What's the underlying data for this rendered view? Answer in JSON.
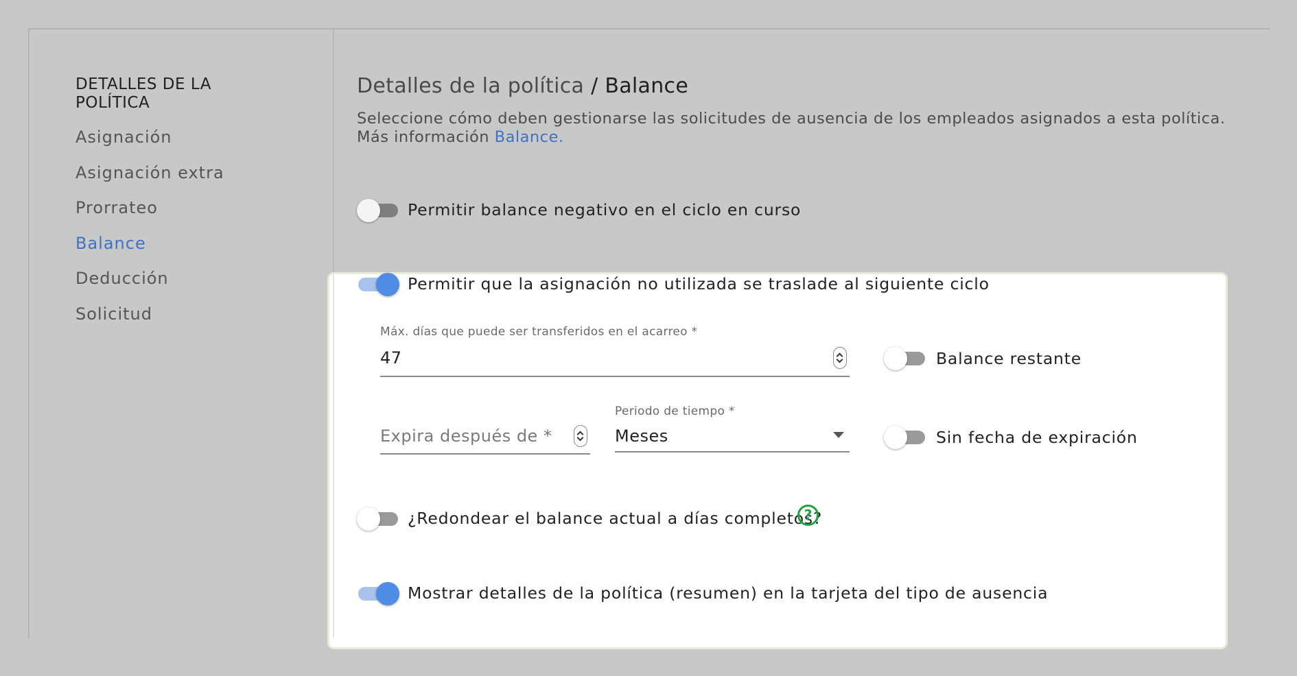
{
  "sidebar": {
    "heading": "DETALLES DE LA POLÍTICA",
    "items": [
      {
        "label": "Asignación",
        "active": false
      },
      {
        "label": "Asignación extra",
        "active": false
      },
      {
        "label": "Prorrateo",
        "active": false
      },
      {
        "label": "Balance",
        "active": true
      },
      {
        "label": "Deducción",
        "active": false
      },
      {
        "label": "Solicitud",
        "active": false
      }
    ]
  },
  "header": {
    "breadcrumb_parent": "Detalles de la política",
    "breadcrumb_separator": " / ",
    "breadcrumb_current": "Balance",
    "description": "Seleccione cómo deben gestionarse las solicitudes de ausencia de los empleados asignados a esta política. Más información ",
    "description_link": "Balance."
  },
  "settings": {
    "negative_balance": {
      "label": "Permitir balance negativo en el ciclo en curso",
      "enabled": false
    },
    "carryover": {
      "label": "Permitir que la asignación no utilizada se traslade al siguiente ciclo",
      "enabled": true
    },
    "max_days": {
      "label": "Máx. días que puede ser transferidos en el acarreo *",
      "value": "47"
    },
    "remaining_balance": {
      "label": "Balance restante",
      "enabled": false
    },
    "expires_after": {
      "placeholder": "Expira después de *",
      "value": ""
    },
    "time_period": {
      "label": "Periodo de tiempo *",
      "value": "Meses"
    },
    "no_expiration": {
      "label": "Sin fecha de expiración",
      "enabled": false
    },
    "round_balance": {
      "label": "¿Redondear el balance actual a días completos?",
      "enabled": false,
      "help_icon": "?"
    },
    "show_details": {
      "label": "Mostrar detalles de la política (resumen) en la tarjeta del tipo de ausencia",
      "enabled": true
    }
  },
  "colors": {
    "accent": "#3d72c9",
    "toggle_on": "#4f8ce6",
    "help_icon": "#1fa341",
    "background": "#c8c8c8"
  }
}
